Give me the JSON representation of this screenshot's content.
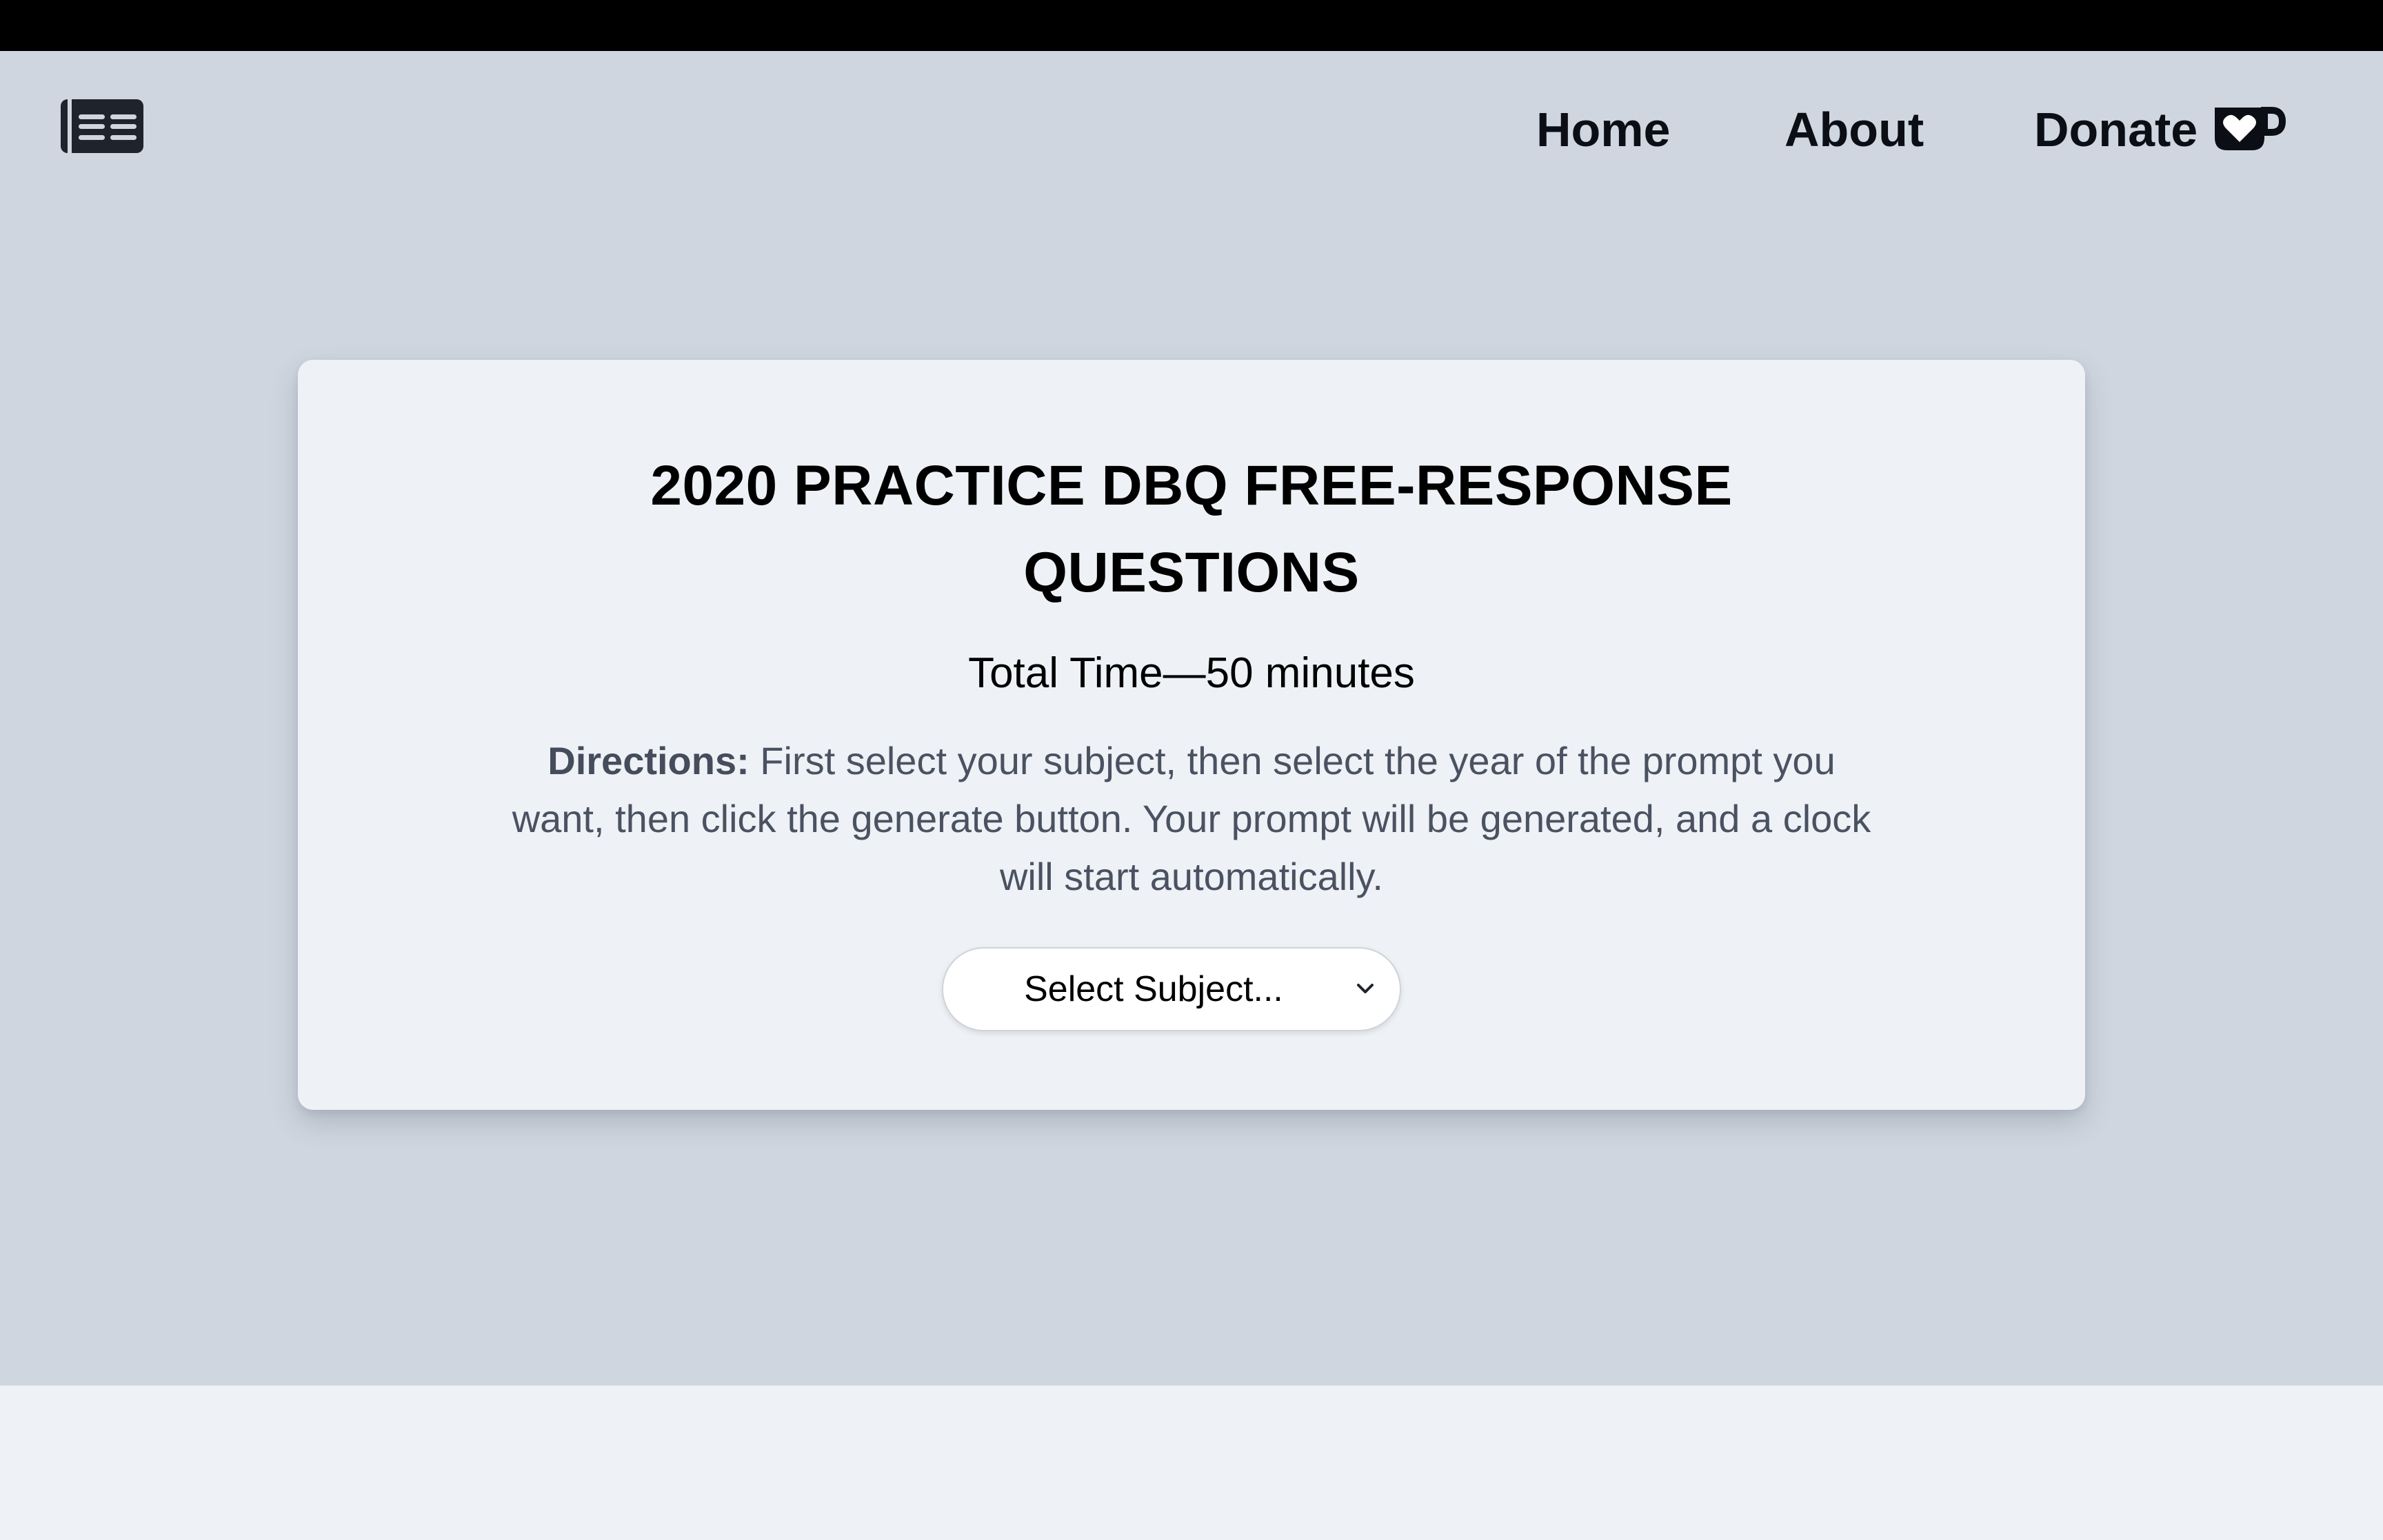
{
  "header": {
    "logo_icon": "newspaper-icon",
    "nav": {
      "home": "Home",
      "about": "About",
      "donate": "Donate",
      "donate_icon": "ko-fi-heart-cup-icon"
    }
  },
  "card": {
    "title_line1": "2020 PRACTICE DBQ FREE-RESPONSE",
    "title_line2": "QUESTIONS",
    "total_time": "Total Time—50 minutes",
    "directions_label": "Directions:",
    "directions_text": " First select your subject, then select the year of the prompt you want, then click the generate button. Your prompt will be generated, and a clock will start automatically.",
    "subject_select": {
      "selected": "Select Subject...",
      "icon": "chevron-down-icon"
    }
  },
  "colors": {
    "topbar": "#000000",
    "page_background": "#cfd6df",
    "card_background": "#eef1f5",
    "directions_text": "#4a5262",
    "nav_text": "#0b0e14"
  }
}
